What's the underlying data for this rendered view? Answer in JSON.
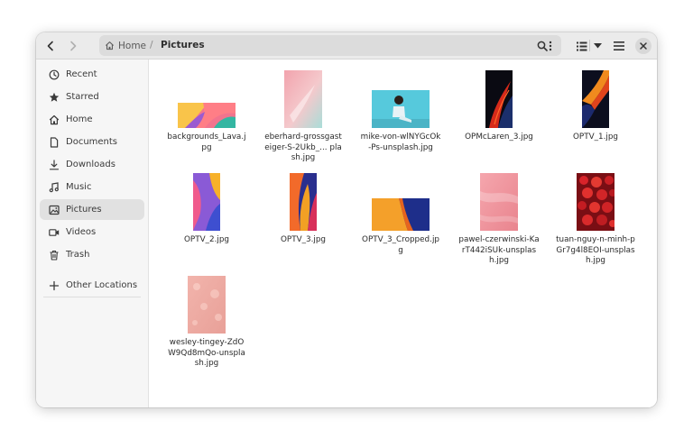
{
  "header": {
    "back_icon": "chevron-left-icon",
    "forward_icon": "chevron-right-icon",
    "breadcrumb": {
      "home_label": "Home",
      "separator": "/",
      "current_label": "Pictures"
    },
    "path_menu_icon": "kebab-menu-icon",
    "search_icon": "search-icon",
    "view_icon": "list-view-icon",
    "view_dropdown_icon": "caret-down-icon",
    "main_menu_icon": "hamburger-menu-icon",
    "close_icon": "close-icon"
  },
  "sidebar": {
    "items": [
      {
        "label": "Recent",
        "icon": "clock-icon"
      },
      {
        "label": "Starred",
        "icon": "star-icon"
      },
      {
        "label": "Home",
        "icon": "home-icon"
      },
      {
        "label": "Documents",
        "icon": "document-icon"
      },
      {
        "label": "Downloads",
        "icon": "download-icon"
      },
      {
        "label": "Music",
        "icon": "music-icon"
      },
      {
        "label": "Pictures",
        "icon": "picture-icon",
        "selected": true
      },
      {
        "label": "Videos",
        "icon": "video-icon"
      },
      {
        "label": "Trash",
        "icon": "trash-icon"
      }
    ],
    "other_locations": {
      "label": "Other Locations",
      "icon": "plus-icon"
    }
  },
  "files": [
    {
      "name": "backgrounds_Lava.jpg"
    },
    {
      "name": "eberhard-grossgasteiger-S-2Ukb_... plash.jpg"
    },
    {
      "name": "mike-von-wlNYGcOk-Ps-unsplash.jpg"
    },
    {
      "name": "OPMcLaren_3.jpg"
    },
    {
      "name": "OPTV_1.jpg"
    },
    {
      "name": "OPTV_2.jpg"
    },
    {
      "name": "OPTV_3.jpg"
    },
    {
      "name": "OPTV_3_Cropped.jpg"
    },
    {
      "name": "pawel-czerwinski-KarT442iSUk-unsplash.jpg"
    },
    {
      "name": "tuan-nguy-n-minh-pGr7g4l8EOI-unsplash.jpg"
    },
    {
      "name": "wesley-tingey-ZdOW9Qd8mQo-unsplash.jpg"
    }
  ],
  "colors": {
    "header_bg": "#ebebeb",
    "sidebar_bg": "#f6f6f6",
    "selected_bg": "#e1e1e1",
    "icon": "#3a3a3a"
  }
}
